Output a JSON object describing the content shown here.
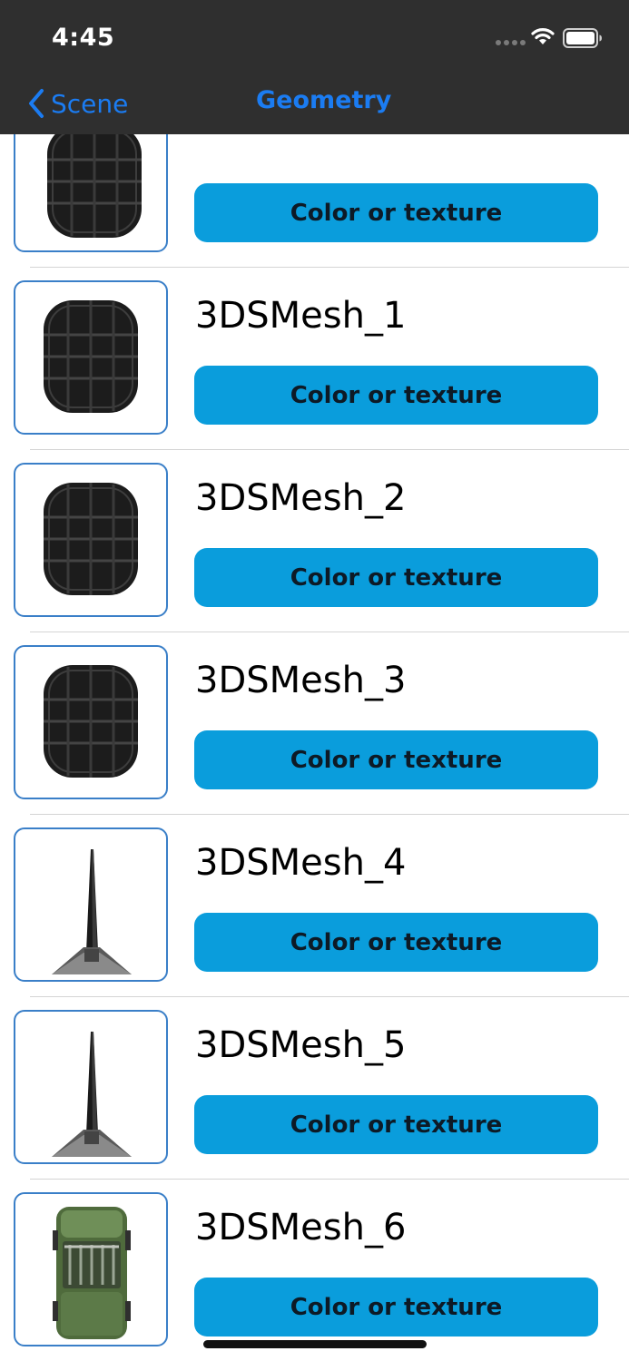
{
  "status_bar": {
    "time": "4:45"
  },
  "nav": {
    "back_label": "Scene",
    "title": "Geometry"
  },
  "rows": [
    {
      "name": "",
      "button_label": "Color or texture",
      "thumbnail": "tire-mesh"
    },
    {
      "name": "3DSMesh_1",
      "button_label": "Color or texture",
      "thumbnail": "tire-mesh"
    },
    {
      "name": "3DSMesh_2",
      "button_label": "Color or texture",
      "thumbnail": "tire-mesh"
    },
    {
      "name": "3DSMesh_3",
      "button_label": "Color or texture",
      "thumbnail": "tire-mesh"
    },
    {
      "name": "3DSMesh_4",
      "button_label": "Color or texture",
      "thumbnail": "spire-mesh"
    },
    {
      "name": "3DSMesh_5",
      "button_label": "Color or texture",
      "thumbnail": "spire-mesh"
    },
    {
      "name": "3DSMesh_6",
      "button_label": "Color or texture",
      "thumbnail": "car-mesh"
    }
  ],
  "colors": {
    "bar_background": "#2f2f2f",
    "accent": "#1b7cf2",
    "button": "#0a9ddc",
    "thumb_border": "#3a7fc8"
  }
}
